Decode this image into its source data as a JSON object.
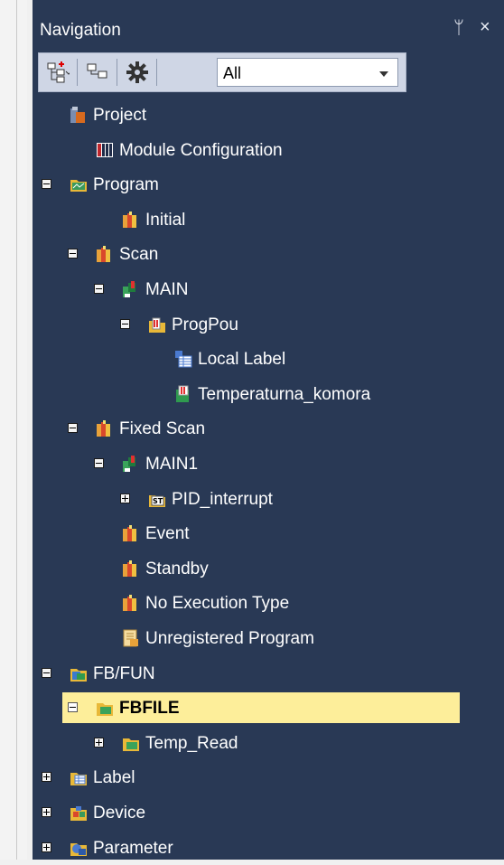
{
  "panel": {
    "title": "Navigation",
    "pin_glyph": "ᛘ",
    "close_glyph": "×"
  },
  "toolbar": {
    "filter_value": "All",
    "buttons": [
      "expand-tree-icon",
      "collapse-tree-icon",
      "gear-icon"
    ]
  },
  "tree": {
    "items": [
      {
        "label": "Project",
        "icon": "project-icon"
      },
      {
        "label": "Module Configuration",
        "icon": "module-config-icon"
      },
      {
        "label": "Program",
        "icon": "program-folder-icon",
        "expanded": true
      },
      {
        "label": "Initial",
        "icon": "task-icon"
      },
      {
        "label": "Scan",
        "icon": "task-icon",
        "expanded": true
      },
      {
        "label": "MAIN",
        "icon": "program-block-icon",
        "expanded": true
      },
      {
        "label": "ProgPou",
        "icon": "pou-icon",
        "expanded": true
      },
      {
        "label": "Local Label",
        "icon": "local-label-icon"
      },
      {
        "label": "Temperaturna_komora",
        "icon": "program-body-icon"
      },
      {
        "label": "Fixed Scan",
        "icon": "task-icon",
        "expanded": true
      },
      {
        "label": "MAIN1",
        "icon": "program-block-icon",
        "expanded": true
      },
      {
        "label": "PID_interrupt",
        "icon": "st-pou-icon",
        "expanded": false
      },
      {
        "label": "Event",
        "icon": "task-icon"
      },
      {
        "label": "Standby",
        "icon": "task-icon"
      },
      {
        "label": "No Execution Type",
        "icon": "task-icon"
      },
      {
        "label": "Unregistered Program",
        "icon": "unregistered-icon"
      },
      {
        "label": "FB/FUN",
        "icon": "fbfun-folder-icon",
        "expanded": true
      },
      {
        "label": "FBFILE",
        "icon": "folder-icon",
        "expanded": true,
        "selected": true
      },
      {
        "label": "Temp_Read",
        "icon": "folder-icon",
        "expanded": false
      },
      {
        "label": "Label",
        "icon": "label-icon",
        "expanded": false
      },
      {
        "label": "Device",
        "icon": "device-icon",
        "expanded": false
      },
      {
        "label": "Parameter",
        "icon": "parameter-icon",
        "expanded": false
      }
    ]
  },
  "colors": {
    "panel_bg": "#293955",
    "selection": "#fdee9a",
    "text": "#ffffff"
  }
}
